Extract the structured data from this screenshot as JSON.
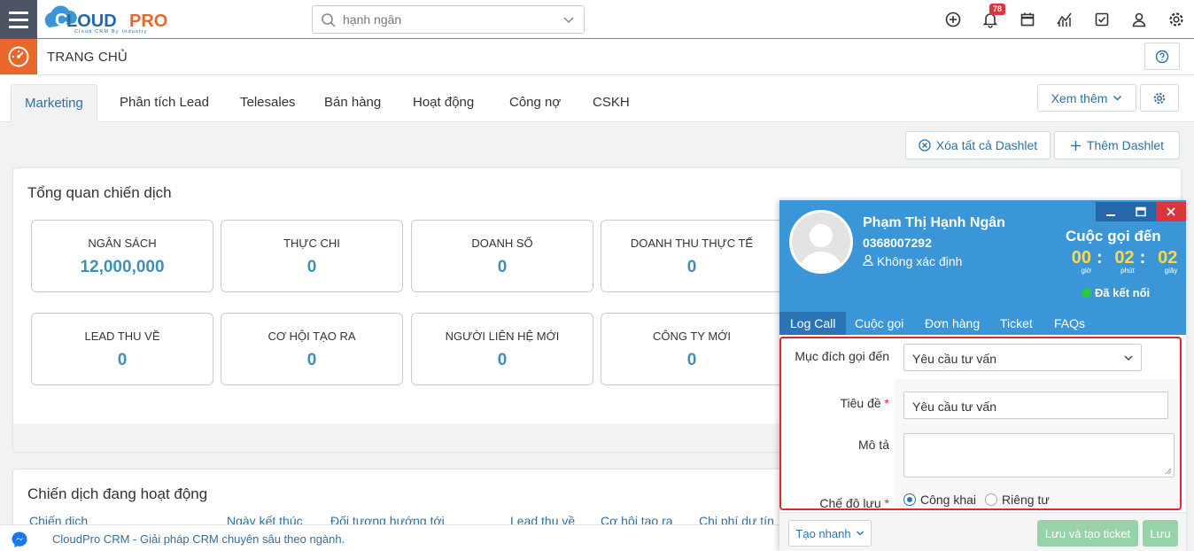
{
  "header": {
    "logo_text": "CLOUDPRO",
    "logo_tagline": "Cloud CRM By Industry",
    "search_value": "hạnh ngân",
    "notification_count": "78",
    "icons": [
      "plus-circle-icon",
      "bell-icon",
      "calendar-icon",
      "chart-icon",
      "checkbox-icon",
      "user-icon",
      "gear-icon"
    ]
  },
  "subbar": {
    "title": "TRANG CHỦ"
  },
  "tabs": [
    {
      "label": "Marketing",
      "active": true
    },
    {
      "label": "Phân tích Lead"
    },
    {
      "label": "Telesales"
    },
    {
      "label": "Bán hàng"
    },
    {
      "label": "Hoạt động"
    },
    {
      "label": "Công nợ"
    },
    {
      "label": "CSKH"
    }
  ],
  "tab_actions": {
    "more": "Xem thêm"
  },
  "dashlet_actions": {
    "clear_all": "Xóa tất cả Dashlet",
    "add": "Thêm Dashlet"
  },
  "overview": {
    "title": "Tổng quan chiến dịch",
    "stats": [
      {
        "label": "NGÂN SÁCH",
        "value": "12,000,000"
      },
      {
        "label": "THỰC CHI",
        "value": "0"
      },
      {
        "label": "DOANH SỐ",
        "value": "0"
      },
      {
        "label": "DOANH THU THỰC TẾ",
        "value": "0"
      },
      {
        "label": "LEAD THU VỀ",
        "value": "0"
      },
      {
        "label": "CƠ HỘI TẠO RA",
        "value": "0"
      },
      {
        "label": "NGƯỜI LIÊN HỆ MỚI",
        "value": "0"
      },
      {
        "label": "CÔNG TY MỚI",
        "value": "0"
      }
    ]
  },
  "active_campaigns": {
    "title": "Chiến dịch đang hoạt động",
    "columns": [
      "Chiến dịch",
      "Ngày kết thúc",
      "Đối tượng hướng tới",
      "Lead thu về",
      "Cơ hội tạo ra",
      "Chi phí dự tín"
    ]
  },
  "footer": {
    "text": "CloudPro CRM - Giải pháp CRM chuyên sâu theo ngành."
  },
  "call_popup": {
    "name": "Phạm Thị Hạnh Ngân",
    "phone": "0368007292",
    "owner": "Không xác định",
    "state": "Cuộc gọi đến",
    "timer": {
      "h": "00",
      "m": "02",
      "s": "02",
      "h_label": "giờ",
      "m_label": "phút",
      "s_label": "giây"
    },
    "connection": "Đã kết nối",
    "tabs": [
      "Log Call",
      "Cuộc gọi",
      "Đơn hàng",
      "Ticket",
      "FAQs"
    ],
    "form": {
      "purpose_label": "Mục đích gọi đến",
      "purpose_value": "Yêu cầu tư vấn",
      "title_label": "Tiêu đề",
      "title_value": "Yêu cầu tư vấn",
      "desc_label": "Mô tả",
      "desc_value": "",
      "mode_label": "Chế độ lưu",
      "mode_public": "Công khai",
      "mode_private": "Riêng tư"
    },
    "footer": {
      "quick": "Tạo nhanh",
      "save_ticket": "Lưu và tạo ticket",
      "save": "Lưu"
    }
  }
}
